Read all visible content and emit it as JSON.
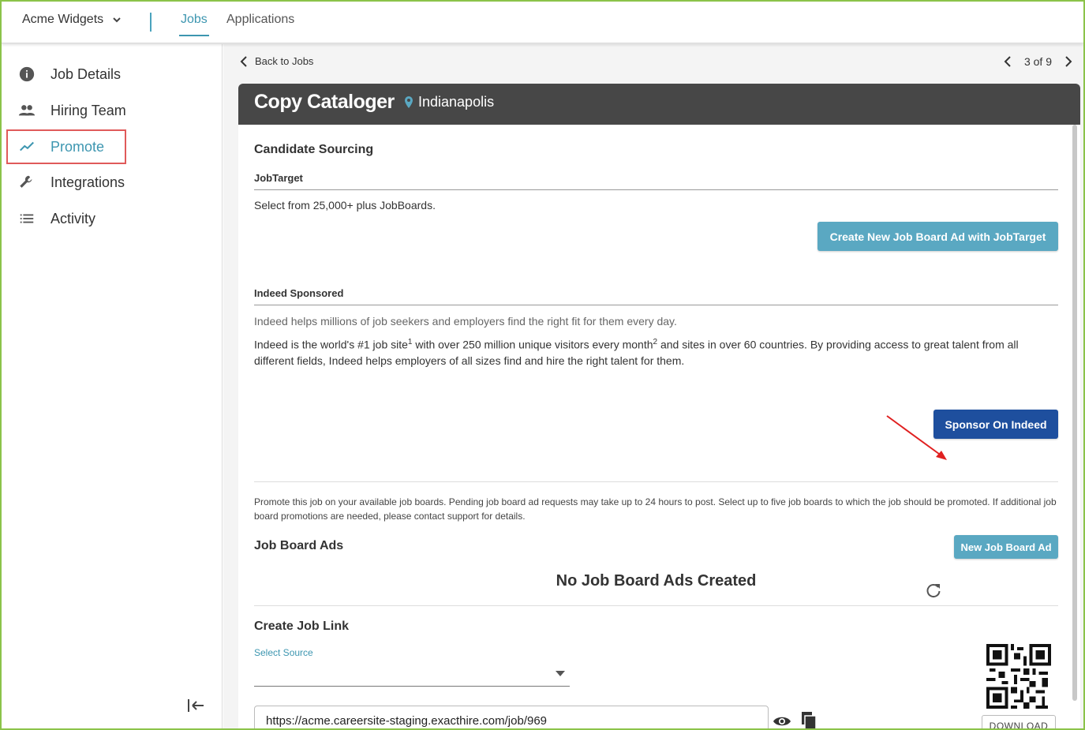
{
  "topbar": {
    "company": "Acme Widgets",
    "tabs": [
      {
        "label": "Jobs",
        "active": true
      },
      {
        "label": "Applications",
        "active": false
      }
    ]
  },
  "sidebar": {
    "items": [
      {
        "label": "Job Details",
        "icon": "info-icon"
      },
      {
        "label": "Hiring Team",
        "icon": "people-icon"
      },
      {
        "label": "Promote",
        "icon": "trend-icon",
        "selected": true
      },
      {
        "label": "Integrations",
        "icon": "wrench-icon"
      },
      {
        "label": "Activity",
        "icon": "list-icon"
      }
    ]
  },
  "nav": {
    "back_label": "Back to Jobs",
    "pager": "3 of 9"
  },
  "job": {
    "title": "Copy Cataloger",
    "location": "Indianapolis"
  },
  "content": {
    "section_title": "Candidate Sourcing",
    "jobtarget": {
      "title": "JobTarget",
      "desc": "Select from 25,000+ plus JobBoards.",
      "button": "Create New Job Board Ad with JobTarget"
    },
    "indeed": {
      "title": "Indeed Sponsored",
      "tagline": "Indeed helps millions of job seekers and employers find the right fit for them every day.",
      "desc_a": "Indeed is the world's #1 job site",
      "sup1": "1",
      "desc_b": " with over 250 million unique visitors every month",
      "sup2": "2",
      "desc_c": " and sites in over 60 countries. By providing access to great talent from all",
      "desc_line2": "different fields, Indeed helps employers of all sizes find and hire the right talent for them.",
      "button": "Sponsor On Indeed"
    },
    "promote_note": "Promote this job on your available job boards. Pending job board ad requests may take up to 24 hours to post. Select up to five job boards to which the job should be promoted. If additional job board promotions are needed, please contact support for details.",
    "job_board_ads": {
      "title": "Job Board Ads",
      "button": "New Job Board Ad",
      "empty": "No Job Board Ads Created"
    },
    "job_link": {
      "title": "Create Job Link",
      "select_label": "Select Source",
      "url": "https://acme.careersite-staging.exacthire.com/job/969",
      "download": "DOWNLOAD"
    }
  },
  "colors": {
    "accent": "#3d96b0",
    "teal_button": "#5aa8c2",
    "navy_button": "#1e4f9e",
    "header_bg": "#474747",
    "highlight_box": "#e05a5a",
    "annotation_arrow": "#e02020"
  }
}
